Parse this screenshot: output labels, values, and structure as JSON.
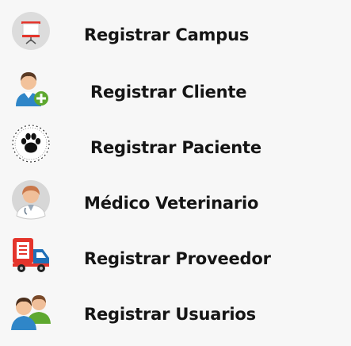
{
  "menu": {
    "items": [
      {
        "label": "Registrar Campus",
        "icon": "presentation-board-icon"
      },
      {
        "label": "Registrar Cliente",
        "icon": "user-add-icon"
      },
      {
        "label": "Registrar Paciente",
        "icon": "paw-print-icon"
      },
      {
        "label": "Médico Veterinario",
        "icon": "doctor-icon"
      },
      {
        "label": "Registrar Proveedor",
        "icon": "delivery-truck-icon"
      },
      {
        "label": "Registrar Usuarios",
        "icon": "users-group-icon"
      }
    ]
  },
  "colors": {
    "background": "#f7f7f7",
    "text": "#151515",
    "accent_red": "#e4342b",
    "accent_green": "#5ea82f",
    "accent_blue": "#1f6fb7"
  }
}
